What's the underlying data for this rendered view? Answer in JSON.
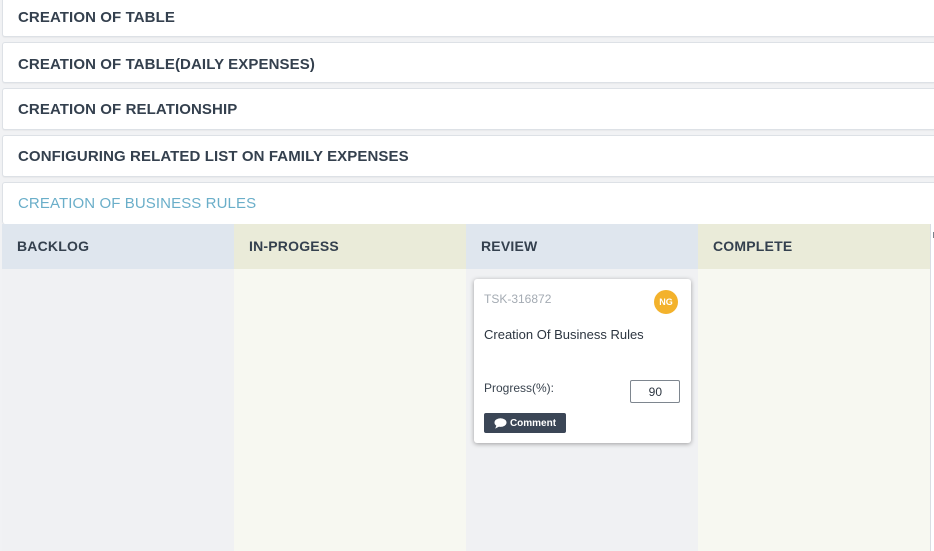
{
  "accordion": {
    "items": [
      {
        "label": "CREATION OF TABLE"
      },
      {
        "label": "CREATION OF TABLE(DAILY EXPENSES)"
      },
      {
        "label": "CREATION OF RELATIONSHIP"
      },
      {
        "label": "CONFIGURING RELATED LIST ON FAMILY EXPENSES"
      },
      {
        "label": "CREATION OF BUSINESS RULES"
      }
    ],
    "active_index": 4
  },
  "board": {
    "columns": [
      {
        "label": "BACKLOG"
      },
      {
        "label": "IN-PROGESS"
      },
      {
        "label": "REVIEW"
      },
      {
        "label": "COMPLETE"
      }
    ]
  },
  "card": {
    "task_id": "TSK-316872",
    "assignee_initials": "NG",
    "title": "Creation Of Business Rules",
    "progress_label": "Progress(%):",
    "progress_value": "90",
    "comment_label": "Comment",
    "column": "REVIEW"
  },
  "colors": {
    "accent": "#6aaec9",
    "avatar": "#f3b22c",
    "button": "#3b4656"
  }
}
